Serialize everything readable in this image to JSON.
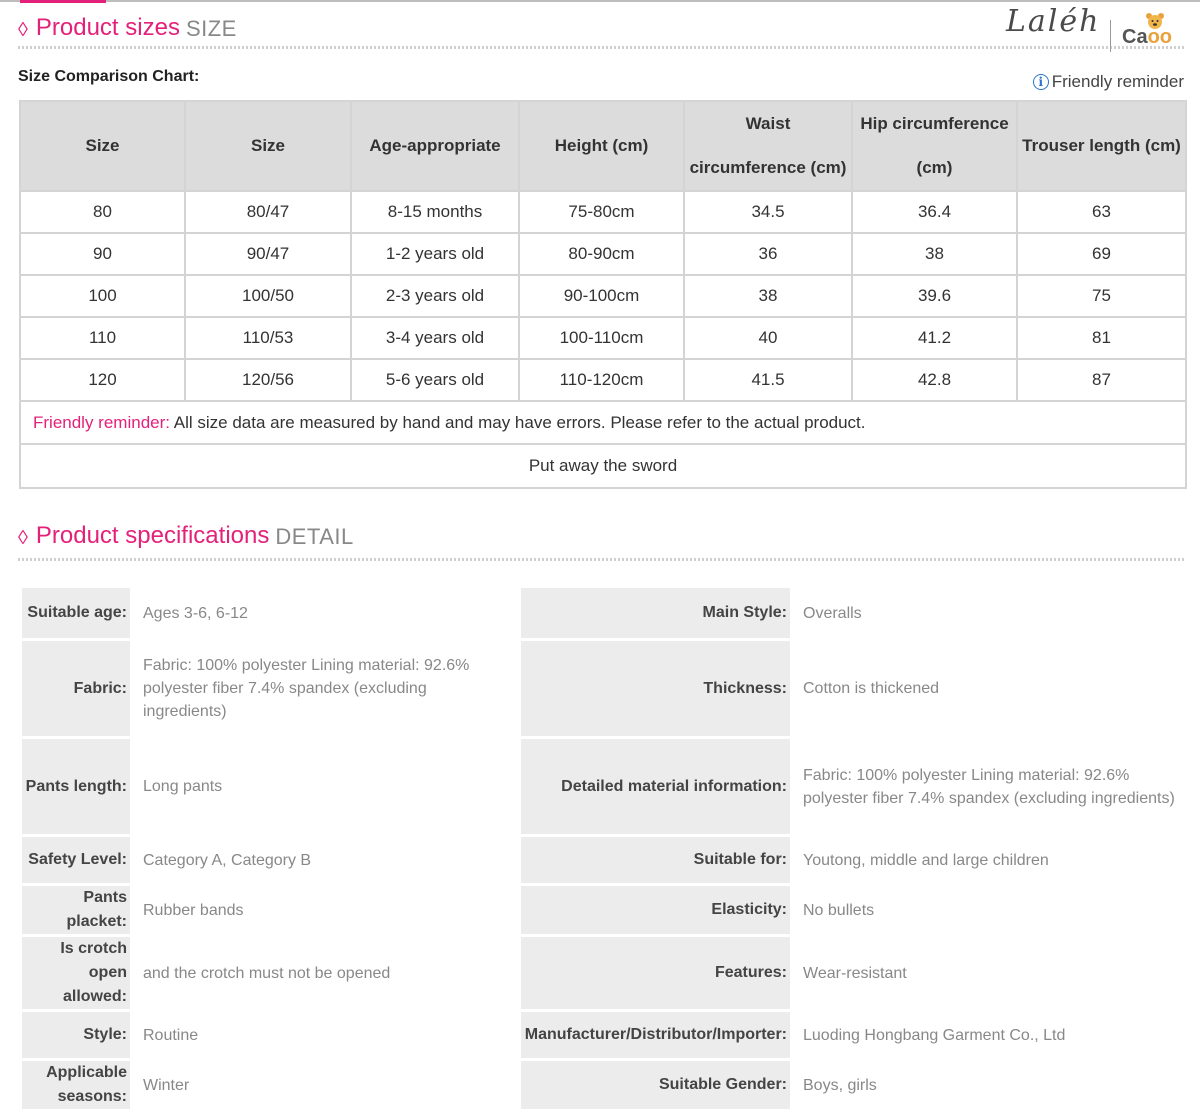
{
  "size_section": {
    "title": "Product sizes",
    "subtitle": "SIZE",
    "chart_label": "Size Comparison Chart:",
    "reminder_label": "Friendly reminder",
    "headers": [
      [
        "Size"
      ],
      [
        "Size"
      ],
      [
        "Age-appropriate"
      ],
      [
        "Height (cm)"
      ],
      [
        "Waist",
        "circumference (cm)"
      ],
      [
        "Hip circumference",
        "(cm)"
      ],
      [
        "Trouser length (cm)"
      ]
    ],
    "rows": [
      [
        "80",
        "80/47",
        "8-15 months",
        "75-80cm",
        "34.5",
        "36.4",
        "63"
      ],
      [
        "90",
        "90/47",
        "1-2 years old",
        "80-90cm",
        "36",
        "38",
        "69"
      ],
      [
        "100",
        "100/50",
        "2-3 years old",
        "90-100cm",
        "38",
        "39.6",
        "75"
      ],
      [
        "110",
        "110/53",
        "3-4 years old",
        "100-110cm",
        "40",
        "41.2",
        "81"
      ],
      [
        "120",
        "120/56",
        "5-6 years old",
        "110-120cm",
        "41.5",
        "42.8",
        "87"
      ]
    ],
    "note_label": "Friendly reminder:",
    "note_text": " All size data are measured by hand and may have errors. Please refer to the actual product.",
    "footer_text": "Put away the sword"
  },
  "spec_section": {
    "title": "Product specifications",
    "subtitle": "DETAIL",
    "rows": [
      {
        "lk": "Suitable age:",
        "lv": "Ages 3-6, 6-12",
        "rk": "Main Style:",
        "rv": "Overalls"
      },
      {
        "lk": "Fabric:",
        "lv": "Fabric: 100% polyester Lining material: 92.6% polyester fiber 7.4% spandex (excluding ingredients)",
        "rk": "Thickness:",
        "rv": "Cotton is thickened"
      },
      {
        "lk": "Pants length:",
        "lv": "Long pants",
        "rk": "Detailed material information:",
        "rv": "Fabric: 100% polyester Lining material: 92.6% polyester fiber 7.4% spandex (excluding ingredients)"
      },
      {
        "lk": "Safety Level:",
        "lv": "Category A, Category B",
        "rk": "Suitable for:",
        "rv": "Youtong, middle and large children"
      },
      {
        "lk": "Pants placket:",
        "lv": "Rubber bands",
        "rk": "Elasticity:",
        "rv": "No bullets"
      },
      {
        "lk": "Is crotch open allowed:",
        "lv": "and the crotch must not be opened",
        "rk": "Features:",
        "rv": "Wear-resistant"
      },
      {
        "lk": "Style:",
        "lv": "Routine",
        "rk": "Manufacturer/Distributor/Importer:",
        "rv": "Luoding Hongbang Garment Co., Ltd"
      },
      {
        "lk": "Applicable seasons:",
        "lv": "Winter",
        "rk": "Suitable Gender:",
        "rv": "Boys, girls"
      }
    ]
  },
  "logo": {
    "script": "Laléh",
    "brand_prefix": "Ca",
    "brand_suffix": "oo"
  },
  "colors": {
    "accent": "#e4217a",
    "header_bg": "#dcdcdc",
    "label_bg": "#ececec",
    "value_text": "#888888"
  }
}
